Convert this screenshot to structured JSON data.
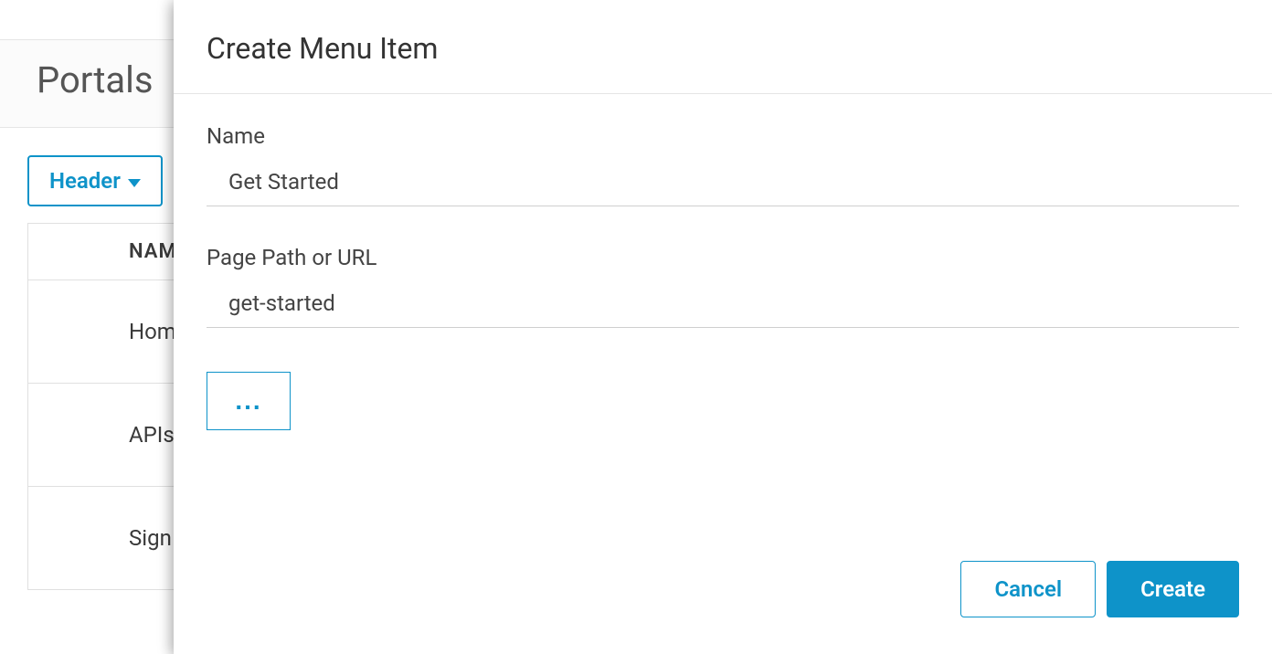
{
  "page": {
    "title": "Portals"
  },
  "dropdown": {
    "label": "Header"
  },
  "table": {
    "header": "NAME",
    "rows": [
      {
        "name": "Home"
      },
      {
        "name": "APIs"
      },
      {
        "name": "Sign In"
      }
    ]
  },
  "modal": {
    "title": "Create Menu Item",
    "name_label": "Name",
    "name_value": "Get Started",
    "path_label": "Page Path or URL",
    "path_value": "get-started",
    "more_label": "...",
    "cancel_label": "Cancel",
    "create_label": "Create"
  }
}
